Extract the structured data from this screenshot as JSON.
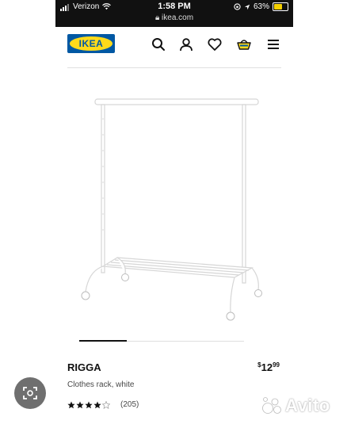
{
  "status_bar": {
    "carrier": "Verizon",
    "time": "1:58 PM",
    "url": "ikea.com",
    "battery": "63%",
    "battery_level": 0.63
  },
  "header": {
    "logo_text": "IKEA",
    "icons": [
      "search-icon",
      "user-icon",
      "heart-icon",
      "cart-icon",
      "menu-icon"
    ]
  },
  "product": {
    "name": "RIGGA",
    "description": "Clothes rack, white",
    "price": {
      "currency": "$",
      "whole": "12",
      "cents": "99"
    },
    "rating": {
      "stars": 4,
      "max": 5,
      "count": "(205)"
    },
    "image_position": 1
  },
  "overlay": {
    "watermark": "Avito",
    "lens_icon": "visual-search-icon"
  },
  "colors": {
    "ikea_blue": "#0058a3",
    "ikea_yellow": "#ffda1a",
    "text": "#111111",
    "muted": "#484848"
  }
}
